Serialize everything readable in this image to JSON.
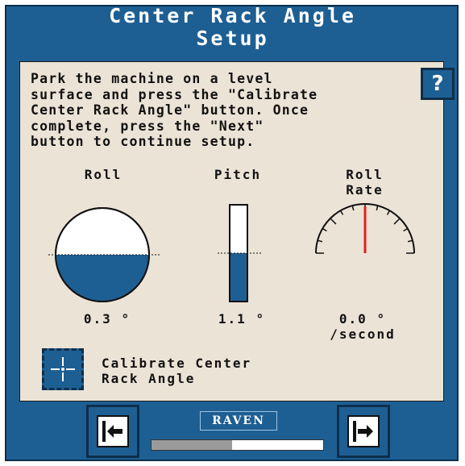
{
  "title": {
    "line1": "Center Rack Angle",
    "line2": "Setup"
  },
  "help_label": "?",
  "instructions": "Park the machine on a level\nsurface and press the \"Calibrate\nCenter Rack Angle\" button. Once\ncomplete, press the \"Next\"\nbutton to continue setup.",
  "roll": {
    "label": "Roll",
    "value": "0.3 °",
    "level_fraction": 0.5
  },
  "pitch": {
    "label": "Pitch",
    "value": "1.1 °",
    "level_fraction": 0.5
  },
  "roll_rate": {
    "label": "Roll\nRate",
    "value": "0.0 °\n/second",
    "needle_value": 0
  },
  "calibrate": {
    "label": "Calibrate Center\nRack Angle",
    "icon": "crosshair-icon"
  },
  "nav": {
    "back_icon": "back-arrow-icon",
    "next_icon": "next-arrow-icon"
  },
  "brand": "RAVEN",
  "progress_fraction": 0.47,
  "colors": {
    "frame": "#1e5f93",
    "panel": "#ebe3d6",
    "fill": "#1e5f93",
    "needle": "#e0201a"
  }
}
